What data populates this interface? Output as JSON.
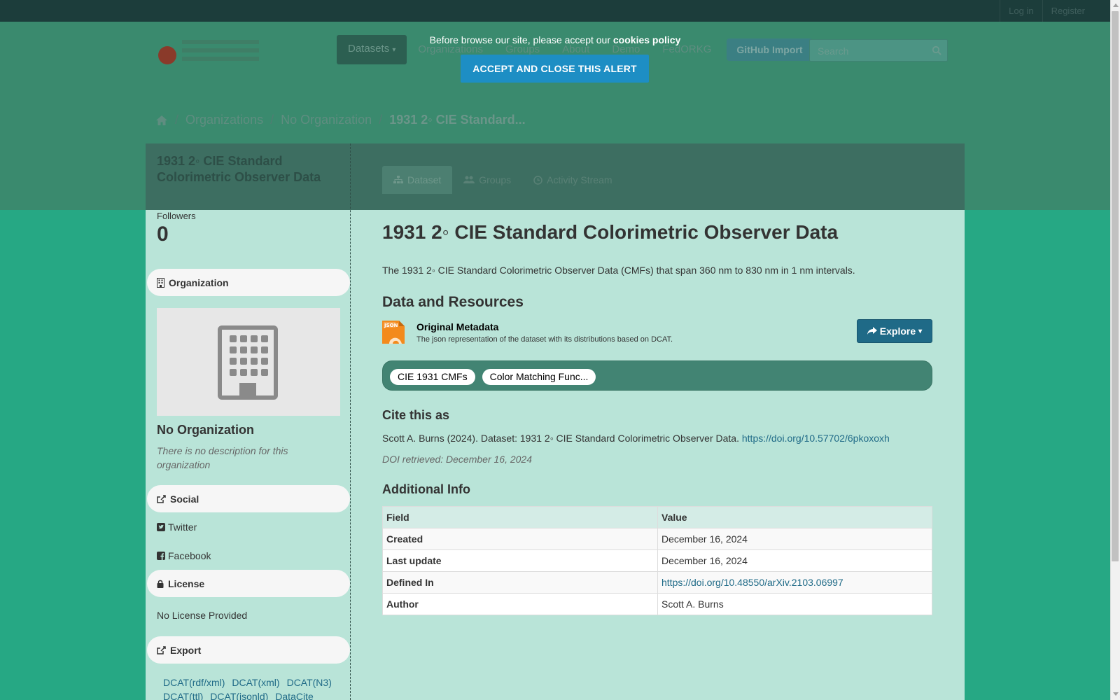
{
  "account": {
    "login": "Log in",
    "register": "Register"
  },
  "nav": {
    "datasets": "Datasets",
    "organizations": "Organizations",
    "groups": "Groups",
    "about": "About",
    "demo": "Demo",
    "fedorkg": "FedORKG",
    "github_import": "GitHub Import"
  },
  "search": {
    "placeholder": "Search"
  },
  "breadcrumb": {
    "organizations": "Organizations",
    "no_org": "No Organization",
    "current": "1931 2◦ CIE Standard..."
  },
  "cookie": {
    "message_prefix": "Before browse our site, please accept our",
    "policy": "cookies policy",
    "button": "ACCEPT AND CLOSE THIS ALERT"
  },
  "aside": {
    "title": "1931 2◦ CIE Standard Colorimetric Observer Data",
    "followers_label": "Followers",
    "followers_count": "0",
    "organization_heading": "Organization",
    "org_name": "No Organization",
    "org_desc": "There is no description for this organization",
    "social_heading": "Social",
    "twitter": "Twitter",
    "facebook": "Facebook",
    "license_heading": "License",
    "license_text": "No License Provided",
    "export_heading": "Export",
    "export_links": [
      "DCAT(rdf/xml)",
      "DCAT(xml)",
      "DCAT(N3)",
      "DCAT(ttl)",
      "DCAT(jsonld)",
      "DataCite"
    ]
  },
  "tabs": {
    "dataset": "Dataset",
    "groups": "Groups",
    "activity": "Activity Stream"
  },
  "dataset": {
    "title": "1931 2◦ CIE Standard Colorimetric Observer Data",
    "notes": "The 1931 2◦ CIE Standard Colorimetric Observer Data (CMFs) that span 360 nm to 830 nm in 1 nm intervals.",
    "resources_heading": "Data and Resources",
    "resource_title": "Original Metadata",
    "resource_desc": "The json representation of the dataset with its distributions based on DCAT.",
    "explore": "Explore",
    "json_icon_label": "JSON",
    "tags": [
      "CIE 1931 CMFs",
      "Color Matching Func..."
    ],
    "cite_heading": "Cite this as",
    "cite_text": "Scott A. Burns (2024). Dataset: 1931 2◦ CIE Standard Colorimetric Observer Data.",
    "cite_link": "https://doi.org/10.57702/6pkoxoxh",
    "doi_retrieved": "DOI retrieved: December 16, 2024",
    "additional_heading": "Additional Info",
    "table_headers": {
      "field": "Field",
      "value": "Value"
    },
    "rows": [
      {
        "field": "Created",
        "value": "December 16, 2024"
      },
      {
        "field": "Last update",
        "value": "December 16, 2024"
      },
      {
        "field": "Defined In",
        "value": "https://doi.org/10.48550/arXiv.2103.06997"
      },
      {
        "field": "Author",
        "value": "Scott A. Burns"
      }
    ]
  },
  "colors": {
    "page_bg": "#26a884",
    "content_bg": "#b9e4d8",
    "link": "#1f6a87",
    "cookie_button": "#1d8ec4",
    "tag_box": "#428473"
  }
}
